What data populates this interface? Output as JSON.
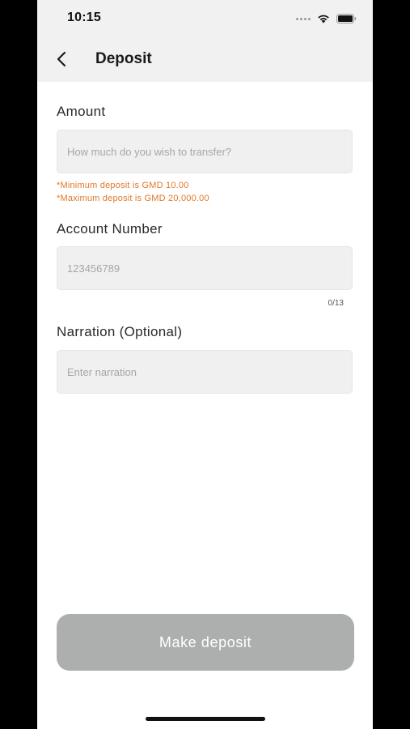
{
  "status_bar": {
    "time": "10:15"
  },
  "header": {
    "title": "Deposit",
    "back_icon": "chevron-left-icon"
  },
  "form": {
    "amount": {
      "label": "Amount",
      "placeholder": "How much do you wish to transfer?",
      "value": "",
      "hints": [
        "*Minimum deposit is GMD 10.00",
        "*Maximum deposit is GMD 20,000.00"
      ]
    },
    "account_number": {
      "label": "Account Number",
      "placeholder": "123456789",
      "value": "",
      "counter": "0/13"
    },
    "narration": {
      "label": "Narration (Optional)",
      "placeholder": "Enter narration",
      "value": ""
    }
  },
  "actions": {
    "submit_label": "Make deposit"
  },
  "colors": {
    "header_bg": "#f1f1f1",
    "field_bg": "#f0f0f0",
    "hint": "#e0782a",
    "button_disabled": "#adafaf"
  }
}
